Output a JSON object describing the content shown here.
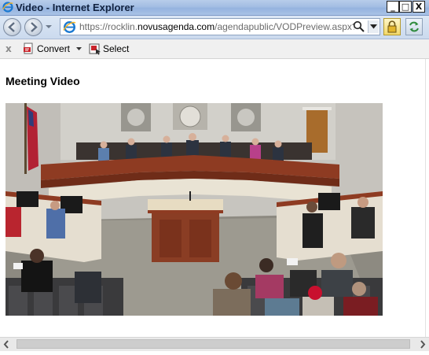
{
  "window": {
    "title": "Video - Internet Explorer",
    "controls": {
      "minimize": "_",
      "maximize": "□",
      "close": "X"
    }
  },
  "address_bar": {
    "url_prefix": "https://rocklin.",
    "url_domain": "novusagenda.com",
    "url_suffix": "/agendapublic/VODPreview.aspx?meetir"
  },
  "command_bar": {
    "close_glyph": "x",
    "items": [
      {
        "label": "Convert",
        "icon": "pdf-convert-icon",
        "has_dropdown": true
      },
      {
        "label": "Select",
        "icon": "select-icon"
      }
    ]
  },
  "page": {
    "heading": "Meeting Video",
    "video": {
      "icon": "council-meeting-video"
    }
  },
  "scrollbar": {
    "orientation": "horizontal"
  },
  "colors": {
    "title_bar": "#a3bde3",
    "accent_blue": "#3e6fb5",
    "podium_wood": "#8d3b24",
    "wall": "#c9c7c2"
  }
}
